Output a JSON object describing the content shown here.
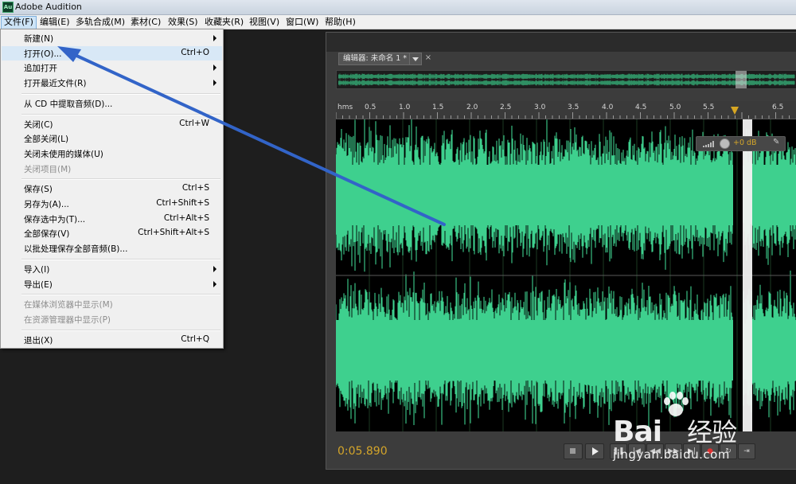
{
  "window": {
    "title": "Adobe Audition",
    "icon_text": "Au"
  },
  "menubar": [
    {
      "label": "文件(F)",
      "active": true
    },
    {
      "label": "编辑(E)"
    },
    {
      "label": "多轨合成(M)"
    },
    {
      "label": "素材(C)"
    },
    {
      "label": "效果(S)"
    },
    {
      "label": "收藏夹(R)"
    },
    {
      "label": "视图(V)"
    },
    {
      "label": "窗口(W)"
    },
    {
      "label": "帮助(H)"
    }
  ],
  "file_menu": {
    "items": [
      {
        "label": "新建(N)",
        "shortcut": "",
        "submenu": true
      },
      {
        "label": "打开(O)...",
        "shortcut": "Ctrl+O",
        "highlighted": true
      },
      {
        "label": "追加打开",
        "shortcut": "",
        "submenu": true
      },
      {
        "label": "打开最近文件(R)",
        "shortcut": "",
        "submenu": true
      },
      {
        "label": "从 CD 中提取音频(D)...",
        "shortcut": ""
      },
      {
        "label": "关闭(C)",
        "shortcut": "Ctrl+W"
      },
      {
        "label": "全部关闭(L)",
        "shortcut": ""
      },
      {
        "label": "关闭未使用的媒体(U)",
        "shortcut": ""
      },
      {
        "label": "关闭项目(M)",
        "shortcut": "",
        "disabled": true
      },
      {
        "label": "保存(S)",
        "shortcut": "Ctrl+S"
      },
      {
        "label": "另存为(A)...",
        "shortcut": "Ctrl+Shift+S"
      },
      {
        "label": "保存选中为(T)...",
        "shortcut": "Ctrl+Alt+S"
      },
      {
        "label": "全部保存(V)",
        "shortcut": "Ctrl+Shift+Alt+S"
      },
      {
        "label": "以批处理保存全部音频(B)...",
        "shortcut": ""
      },
      {
        "label": "导入(I)",
        "shortcut": "",
        "submenu": true
      },
      {
        "label": "导出(E)",
        "shortcut": "",
        "submenu": true
      },
      {
        "label": "在媒体浏览器中显示(M)",
        "shortcut": "",
        "disabled": true
      },
      {
        "label": "在资源管理器中显示(P)",
        "shortcut": "",
        "disabled": true
      },
      {
        "label": "退出(X)",
        "shortcut": "Ctrl+Q"
      }
    ]
  },
  "editor": {
    "tab_label": "编辑器: 未命名 1 *",
    "tab_close": "×",
    "ruler_unit": "hms",
    "ruler_labels": [
      "0.5",
      "1.0",
      "1.5",
      "2.0",
      "2.5",
      "3.0",
      "3.5",
      "4.0",
      "4.5",
      "5.0",
      "5.5",
      "6.5"
    ],
    "hud_gain": "+0 dB",
    "time": "0:05.890",
    "colors": {
      "waveform": "#3ed08e",
      "time": "#d4a52a",
      "playhead": "#d7a622"
    }
  },
  "watermark": {
    "logo_a": "Bai",
    "logo_b": "经验",
    "url": "jingyan.baidu.com"
  }
}
